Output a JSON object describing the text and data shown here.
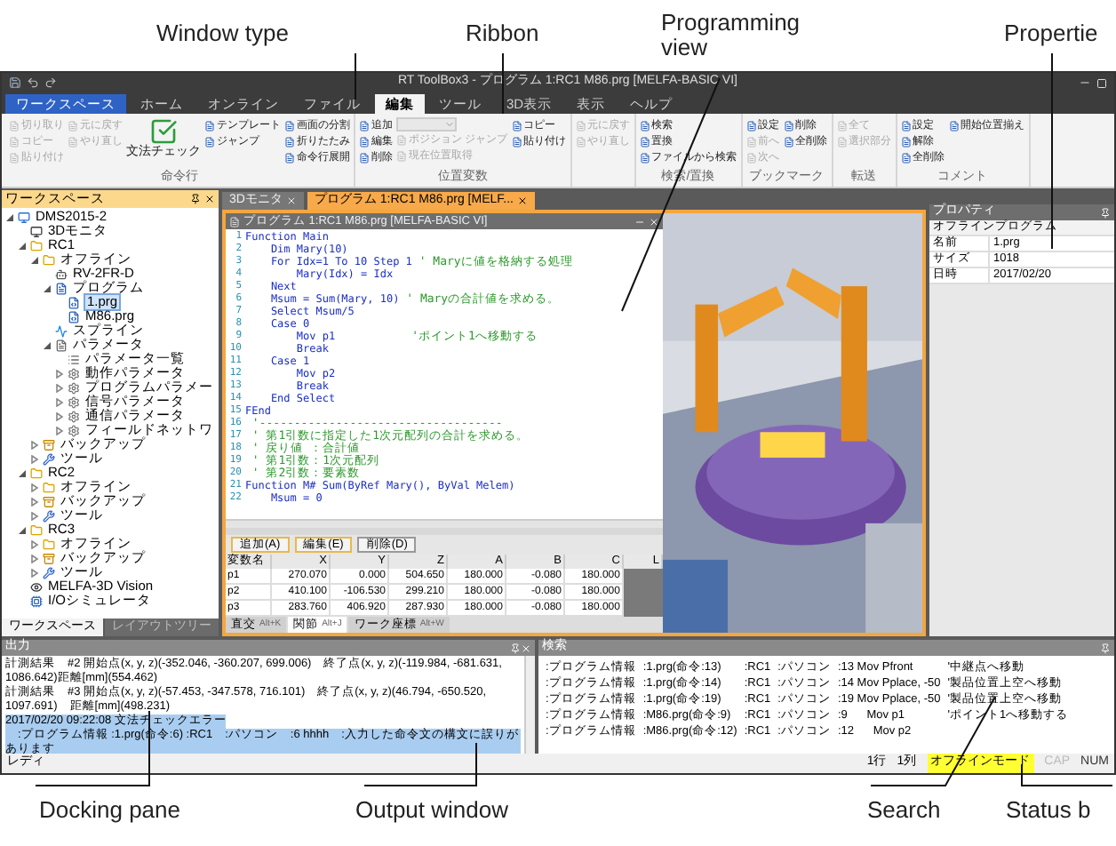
{
  "callouts_top": [
    {
      "label": "Window type"
    },
    {
      "label": "Ribbon"
    },
    {
      "label": "Programming view"
    },
    {
      "label": "Propertie"
    }
  ],
  "window": {
    "title": "RT ToolBox3 - プログラム 1:RC1 M86.prg  [MELFA-BASIC VI]"
  },
  "menu_tabs": [
    {
      "label": "ワークスペース",
      "kind": "file"
    },
    {
      "label": "ホーム",
      "kind": "tab",
      "selected": false
    },
    {
      "label": "オンライン",
      "kind": "tab",
      "selected": false
    },
    {
      "label": "ファイル",
      "kind": "tab",
      "selected": false
    },
    {
      "label": "編集",
      "kind": "tab",
      "selected": true
    },
    {
      "label": "ツール",
      "kind": "tab",
      "selected": false
    },
    {
      "label": "3D表示",
      "kind": "tab",
      "selected": false
    },
    {
      "label": "表示",
      "kind": "tab",
      "selected": false
    },
    {
      "label": "ヘルプ",
      "kind": "tab",
      "selected": false
    }
  ],
  "ribbon": {
    "groups": [
      {
        "label": "命令行",
        "columns": [
          [
            {
              "kind": "small",
              "label": "切り取り",
              "disabled": true
            },
            {
              "kind": "small",
              "label": "コピー",
              "disabled": true
            },
            {
              "kind": "small",
              "label": "貼り付け",
              "disabled": true
            }
          ],
          [
            {
              "kind": "small",
              "label": "元に戻す",
              "disabled": true
            },
            {
              "kind": "small",
              "label": "やり直し",
              "disabled": true
            }
          ],
          [
            {
              "kind": "large",
              "label": "文法チェック",
              "disabled": false
            }
          ],
          [
            {
              "kind": "small",
              "label": "テンプレート",
              "disabled": false
            },
            {
              "kind": "small",
              "label": "ジャンプ",
              "disabled": false
            }
          ],
          [
            {
              "kind": "small",
              "label": "画面の分割",
              "disabled": false
            },
            {
              "kind": "small",
              "label": "折りたたみ",
              "disabled": false
            },
            {
              "kind": "small",
              "label": "命令行展開",
              "disabled": false
            }
          ]
        ]
      },
      {
        "label": "位置変数",
        "columns": [
          [
            {
              "kind": "small",
              "label": "追加",
              "disabled": false
            },
            {
              "kind": "small",
              "label": "編集",
              "disabled": false
            },
            {
              "kind": "small",
              "label": "削除",
              "disabled": false
            }
          ],
          [
            {
              "kind": "combo",
              "disabled": true
            },
            {
              "kind": "small",
              "label": "ポジション ジャンプ",
              "disabled": true
            },
            {
              "kind": "small",
              "label": "現在位置取得",
              "disabled": true
            }
          ],
          [
            {
              "kind": "small",
              "label": "コピー",
              "disabled": false
            },
            {
              "kind": "small",
              "label": "貼り付け",
              "disabled": false
            }
          ]
        ]
      },
      {
        "columns": [
          [
            {
              "kind": "small",
              "label": "元に戻す",
              "disabled": true
            },
            {
              "kind": "small",
              "label": "やり直し",
              "disabled": true
            }
          ]
        ]
      },
      {
        "label": "検索/置換",
        "columns": [
          [
            {
              "kind": "small",
              "label": "検索",
              "disabled": false
            },
            {
              "kind": "small",
              "label": "置換",
              "disabled": false
            },
            {
              "kind": "small",
              "label": "ファイルから検索",
              "disabled": false
            }
          ]
        ]
      },
      {
        "label": "ブックマーク",
        "columns": [
          [
            {
              "kind": "small",
              "label": "設定",
              "disabled": false
            },
            {
              "kind": "small",
              "label": "前へ",
              "disabled": true
            },
            {
              "kind": "small",
              "label": "次へ",
              "disabled": true
            }
          ],
          [
            {
              "kind": "small",
              "label": "削除",
              "disabled": false
            },
            {
              "kind": "small",
              "label": "全削除",
              "disabled": false
            }
          ]
        ]
      },
      {
        "label": "転送",
        "columns": [
          [
            {
              "kind": "small",
              "label": "全て",
              "disabled": true
            },
            {
              "kind": "small",
              "label": "選択部分",
              "disabled": true
            }
          ]
        ]
      },
      {
        "label": "コメント",
        "columns": [
          [
            {
              "kind": "small",
              "label": "設定",
              "disabled": false
            },
            {
              "kind": "small",
              "label": "解除",
              "disabled": false
            },
            {
              "kind": "small",
              "label": "全削除",
              "disabled": false
            }
          ],
          [
            {
              "kind": "small",
              "label": "開始位置揃え",
              "disabled": false
            }
          ]
        ]
      }
    ]
  },
  "workspace": {
    "title": "ワークスペース",
    "tree": [
      {
        "label": "DMS2015-2",
        "kind": "project",
        "expanded": true,
        "selected": false,
        "children": [
          {
            "label": "3Dモニタ",
            "kind": "monitor",
            "selected": false
          },
          {
            "label": "RC1",
            "kind": "controller",
            "expanded": true,
            "selected": false,
            "children": [
              {
                "label": "オフライン",
                "kind": "controller",
                "expanded": true,
                "selected": false,
                "children": [
                  {
                    "label": "RV-2FR-D",
                    "kind": "robot",
                    "selected": false
                  },
                  {
                    "label": "プログラム",
                    "kind": "programs",
                    "expanded": true,
                    "selected": false,
                    "children": [
                      {
                        "label": "1.prg",
                        "kind": "file",
                        "selected": true
                      },
                      {
                        "label": "M86.prg",
                        "kind": "file",
                        "selected": false
                      }
                    ]
                  },
                  {
                    "label": "スプライン",
                    "kind": "spline",
                    "selected": false
                  },
                  {
                    "label": "パラメータ",
                    "kind": "params",
                    "expanded": true,
                    "selected": false,
                    "children": [
                      {
                        "label": "パラメータ一覧",
                        "kind": "list",
                        "selected": false
                      },
                      {
                        "label": "動作パラメータ",
                        "kind": "param",
                        "expanded": false,
                        "selected": false
                      },
                      {
                        "label": "プログラムパラメー",
                        "kind": "param",
                        "expanded": false,
                        "selected": false
                      },
                      {
                        "label": "信号パラメータ",
                        "kind": "param",
                        "expanded": false,
                        "selected": false
                      },
                      {
                        "label": "通信パラメータ",
                        "kind": "param",
                        "expanded": false,
                        "selected": false
                      },
                      {
                        "label": "フィールドネットワ",
                        "kind": "param",
                        "expanded": false,
                        "selected": false
                      }
                    ]
                  }
                ]
              },
              {
                "label": "バックアップ",
                "kind": "backup",
                "expanded": false,
                "selected": false
              },
              {
                "label": "ツール",
                "kind": "tool",
                "expanded": false,
                "selected": false
              }
            ]
          },
          {
            "label": "RC2",
            "kind": "controller",
            "expanded": true,
            "selected": false,
            "children": [
              {
                "label": "オフライン",
                "kind": "controller",
                "expanded": false,
                "selected": false
              },
              {
                "label": "バックアップ",
                "kind": "backup",
                "expanded": false,
                "selected": false
              },
              {
                "label": "ツール",
                "kind": "tool",
                "expanded": false,
                "selected": false
              }
            ]
          },
          {
            "label": "RC3",
            "kind": "controller",
            "expanded": true,
            "selected": false,
            "children": [
              {
                "label": "オフライン",
                "kind": "controller",
                "expanded": false,
                "selected": false
              },
              {
                "label": "バックアップ",
                "kind": "backup",
                "expanded": false,
                "selected": false
              },
              {
                "label": "ツール",
                "kind": "tool",
                "expanded": false,
                "selected": false
              }
            ]
          },
          {
            "label": "MELFA-3D Vision",
            "kind": "vision",
            "selected": false
          },
          {
            "label": "I/Oシミュレータ",
            "kind": "simulator",
            "selected": false
          }
        ]
      }
    ],
    "bottom_tabs": [
      {
        "label": "ワークスペース",
        "selected": true
      },
      {
        "label": "レイアウトツリー",
        "selected": false
      }
    ]
  },
  "doc_tabs": [
    {
      "label": "3Dモニタ",
      "selected": false
    },
    {
      "label": "プログラム 1:RC1 M86.prg  [MELF...",
      "selected": true
    }
  ],
  "editor": {
    "title": "プログラム 1:RC1 M86.prg  [MELFA-BASIC VI]",
    "lines": [
      {
        "num": "1",
        "code": "Function Main"
      },
      {
        "num": "2",
        "code": "    Dim Mary(10)"
      },
      {
        "num": "3",
        "code": "    For Idx=1 To 10 Step 1",
        "comment": " ' Maryに値を格納する処理"
      },
      {
        "num": "4",
        "code": "        Mary(Idx) = Idx"
      },
      {
        "num": "5",
        "code": "    Next"
      },
      {
        "num": "6",
        "code": "    Msum = Sum(Mary, 10)",
        "comment": " ' Maryの合計値を求める。"
      },
      {
        "num": "7",
        "code": "    Select Msum/5"
      },
      {
        "num": "8",
        "code": "    Case 0"
      },
      {
        "num": "9",
        "code": "        Mov p1",
        "comment": "           'ポイント1へ移動する"
      },
      {
        "num": "10",
        "code": "        Break"
      },
      {
        "num": "11",
        "code": "    Case 1"
      },
      {
        "num": "12",
        "code": "        Mov p2"
      },
      {
        "num": "13",
        "code": "        Break"
      },
      {
        "num": "14",
        "code": "    End Select"
      },
      {
        "num": "15",
        "code": "FEnd"
      },
      {
        "num": "16",
        "comment": " '-----------------------------------"
      },
      {
        "num": "17",
        "comment": " ' 第1引数に指定した1次元配列の合計を求める。"
      },
      {
        "num": "18",
        "comment": " ' 戻り値 ：合計値"
      },
      {
        "num": "19",
        "comment": " ' 第1引数：1次元配列"
      },
      {
        "num": "20",
        "comment": " ' 第2引数：要素数"
      },
      {
        "num": "21",
        "code": "Function M# Sum(ByRef Mary(), ByVal Melem)"
      },
      {
        "num": "22",
        "code": "    Msum = 0"
      }
    ]
  },
  "position_table": {
    "buttons": [
      "追加(A)",
      "編集(E)",
      "削除(D)"
    ],
    "columns": [
      "変数名",
      "X",
      "Y",
      "Z",
      "A",
      "B",
      "C",
      "L"
    ],
    "rows": [
      [
        "p1",
        "270.070",
        "0.000",
        "504.650",
        "180.000",
        "-0.080",
        "180.000"
      ],
      [
        "p2",
        "410.100",
        "-106.530",
        "299.210",
        "180.000",
        "-0.080",
        "180.000"
      ],
      [
        "p3",
        "283.760",
        "406.920",
        "287.930",
        "180.000",
        "-0.080",
        "180.000"
      ]
    ],
    "tabs": [
      {
        "label": "直交",
        "shortcut": "Alt+K",
        "selected": false
      },
      {
        "label": "関節",
        "shortcut": "Alt+J",
        "selected": true
      },
      {
        "label": "ワーク座標",
        "shortcut": "Alt+W",
        "selected": false
      }
    ]
  },
  "properties": {
    "title": "プロパティ",
    "subtitle": "オフラインプログラム",
    "rows": [
      {
        "name": "名前",
        "value": "1.prg"
      },
      {
        "name": "サイズ",
        "value": "1018"
      },
      {
        "name": "日時",
        "value": "2017/02/20"
      }
    ]
  },
  "output": {
    "title": "出力",
    "lines": [
      {
        "text": "計測結果　#2 開始点(x, y, z)(-352.046, -360.207, 699.006)　終了点(x, y, z)(-119.984, -681.631, 1086.642)距離[mm](554.462)",
        "highlighted": false
      },
      {
        "text": "計測結果　#3 開始点(x, y, z)(-57.453, -347.578, 716.101)　終了点(x, y, z)(46.794, -650.520, 1097.691)　距離[mm](498.231)",
        "highlighted": false
      },
      {
        "text": "2017/02/20 09:22:08 文法チェックエラー",
        "highlighted": true
      },
      {
        "text": "　:プログラム情報 :1.prg(命令:6) :RC1　:パソコン　:6 hhhh　:入力した命令文の構文に誤りがあります",
        "highlighted": true
      }
    ]
  },
  "search": {
    "title": "検索",
    "rows": [
      [
        ":プログラム情報",
        ":1.prg(命令:13)",
        ":RC1",
        ":パソコン",
        ":13 Mov Pfront",
        "'中継点へ移動"
      ],
      [
        ":プログラム情報",
        ":1.prg(命令:14)",
        ":RC1",
        ":パソコン",
        ":14 Mov Pplace, -50",
        "'製品位置上空へ移動"
      ],
      [
        ":プログラム情報",
        ":1.prg(命令:19)",
        ":RC1",
        ":パソコン",
        ":19 Mov Pplace, -50",
        "'製品位置上空へ移動"
      ],
      [
        ":プログラム情報",
        ":M86.prg(命令:9)",
        ":RC1",
        ":パソコン",
        ":9      Mov p1",
        "'ポイント1へ移動する"
      ],
      [
        ":プログラム情報",
        ":M86.prg(命令:12)",
        ":RC1",
        ":パソコン",
        ":12      Mov p2"
      ]
    ]
  },
  "status_bar": {
    "message": "レディ",
    "line": "1行",
    "column": "1列",
    "mode": "オフラインモード",
    "keys": [
      {
        "label": "CAP",
        "on": false
      },
      {
        "label": "NUM",
        "on": true
      }
    ]
  },
  "callouts_bottom": [
    {
      "label": "Docking pane"
    },
    {
      "label": "Output window"
    },
    {
      "label": "Search"
    },
    {
      "label": "Status b"
    }
  ]
}
